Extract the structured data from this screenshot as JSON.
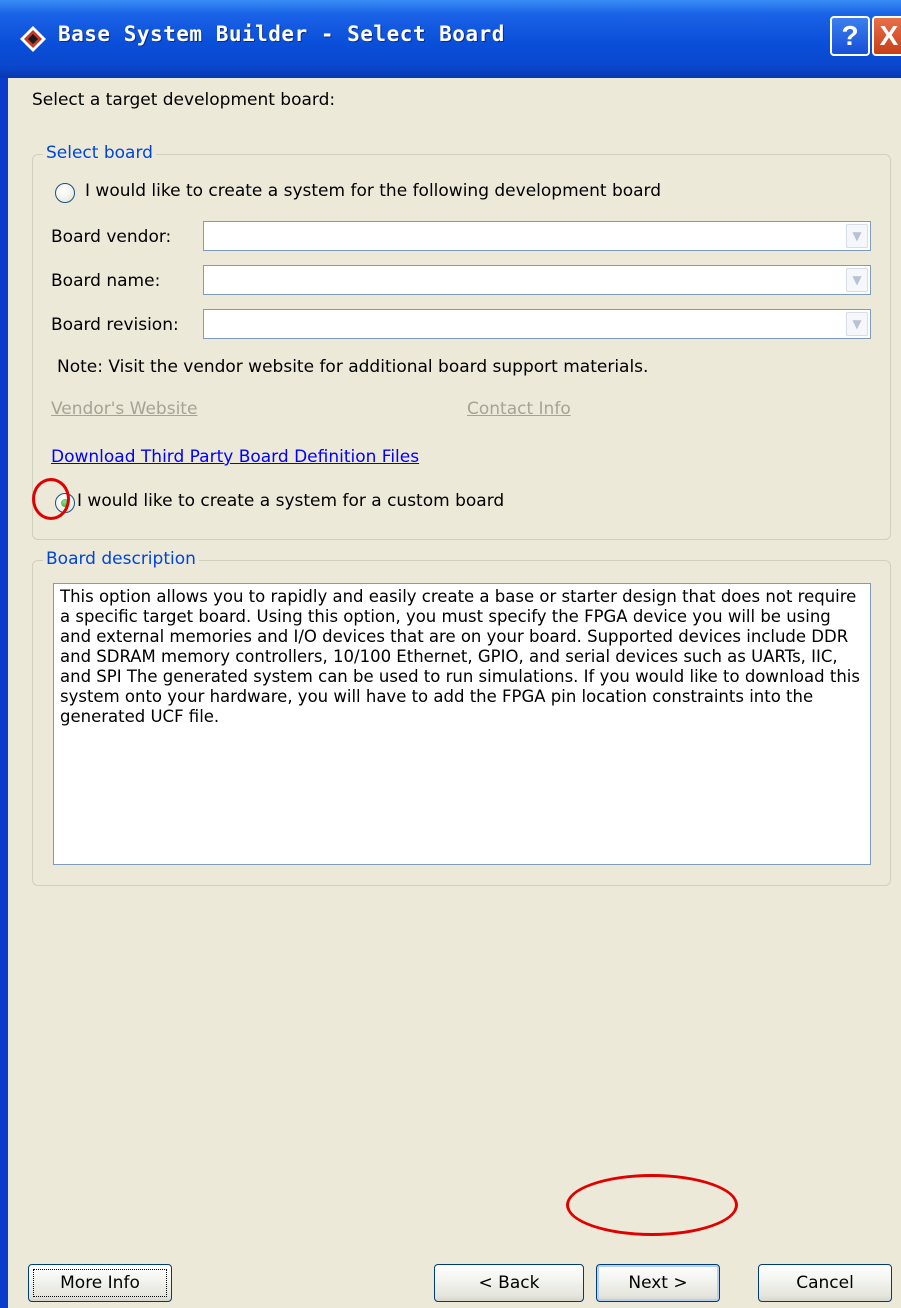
{
  "window": {
    "title": "Base System Builder - Select Board",
    "help_label": "?",
    "close_label": "X"
  },
  "intro": "Select a target development board:",
  "select_board": {
    "legend": "Select board",
    "dev_board_option": "I would like to create a system for the following development board",
    "dev_board_selected": false,
    "fields": [
      {
        "label": "Board vendor:",
        "value": ""
      },
      {
        "label": "Board name:",
        "value": ""
      },
      {
        "label": "Board revision:",
        "value": ""
      }
    ],
    "note": "Note: Visit the vendor website for additional board support materials.",
    "vendor_website": "Vendor's Website",
    "contact_info": "Contact Info",
    "download_link": "Download Third Party Board Definition Files",
    "custom_board_option": "I would like to create a system for a custom board",
    "custom_board_selected": true
  },
  "board_description": {
    "legend": "Board description",
    "text": "This option allows you to rapidly and easily create a base or starter design that does not require a specific target board.  Using this option, you must specify the FPGA device you will be using and external memories and I/O devices that are on your board.  Supported devices include DDR and SDRAM memory controllers, 10/100 Ethernet, GPIO, and serial devices such as UARTs, IIC, and SPI  The generated system can be used to run simulations.  If you would like to download this system onto your hardware, you will have to add the FPGA pin location constraints into the generated UCF file."
  },
  "buttons": {
    "more_info": "More Info",
    "back": "< Back",
    "next": "Next >",
    "cancel": "Cancel"
  },
  "colors": {
    "titlebar": "#0a4fd9",
    "dialog_bg": "#ece9d8",
    "group_legend": "#0046d5",
    "link": "#0000ff",
    "annotation": "#e00000"
  }
}
